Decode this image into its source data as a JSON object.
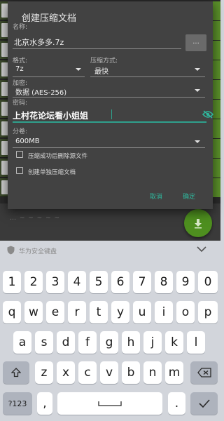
{
  "dialog": {
    "title": "创建压缩文档",
    "name_label": "名称:",
    "name_value": "北京水多多.7z",
    "dots_button": "...",
    "format_label": "格式:",
    "format_value": "7z",
    "method_label": "压缩方式:",
    "method_value": "最快",
    "encryption_label": "加密:",
    "encryption_value": "数据 (AES-256)",
    "password_label": "密码:",
    "password_value": "上村花论坛看小姐姐",
    "split_label": "分卷:",
    "split_value": "600MB",
    "checkbox_delete": "压缩成功后删除源文件",
    "checkbox_separate": "创建单独压缩文档",
    "cancel": "取消",
    "ok": "确定"
  },
  "keyboard": {
    "brand": "华为安全键盘",
    "row1": [
      "1",
      "2",
      "3",
      "4",
      "5",
      "6",
      "7",
      "8",
      "9",
      "0"
    ],
    "row2": [
      "q",
      "w",
      "e",
      "r",
      "t",
      "y",
      "u",
      "i",
      "o",
      "p"
    ],
    "row3": [
      "a",
      "s",
      "d",
      "f",
      "g",
      "h",
      "j",
      "k",
      "l"
    ],
    "row4": [
      "z",
      "x",
      "c",
      "v",
      "b",
      "n",
      "m"
    ],
    "symbols": "?123",
    "comma": ",",
    "period": "."
  },
  "background": {
    "bottom_text": "… ~ ~ ~ ~ ~"
  },
  "colors": {
    "accent": "#2fb69c",
    "dialog_bg": "#424242",
    "fab": "#4e8f1f",
    "keyboard_bg": "#d2d5db"
  }
}
